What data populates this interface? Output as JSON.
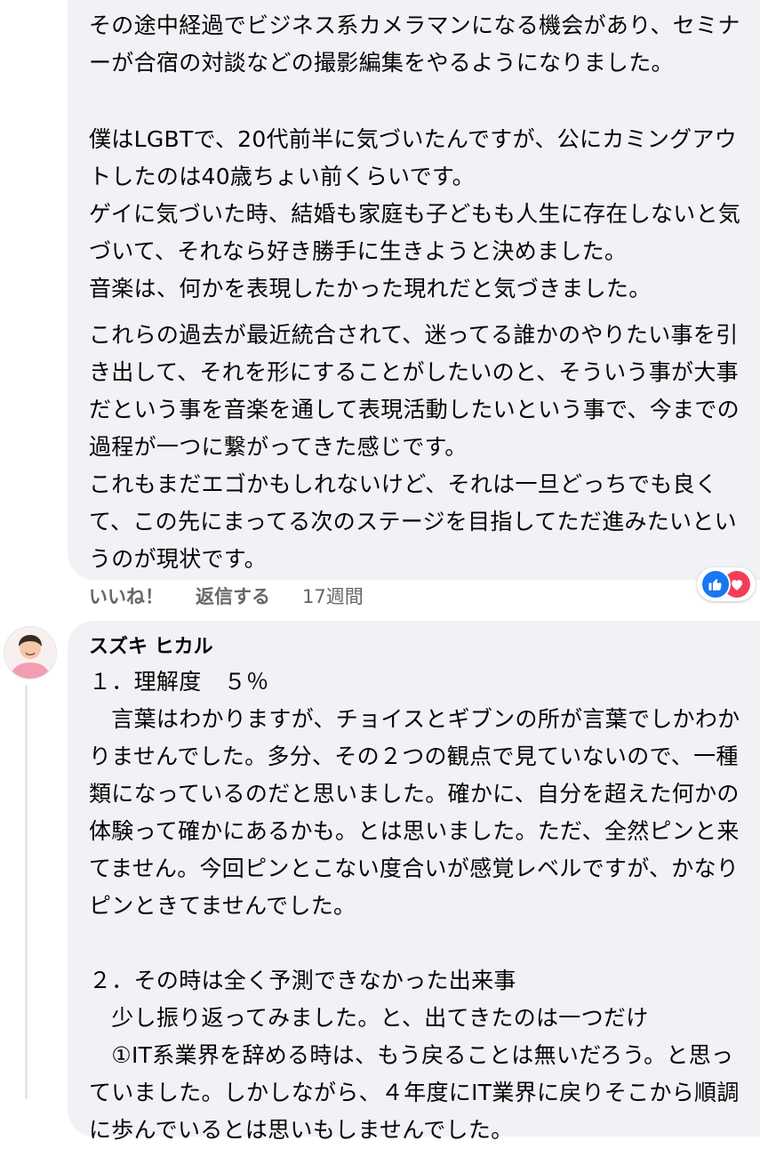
{
  "comment1": {
    "paragraphs": [
      "その途中経過でビジネス系カメラマンになる機会があり、セミナーが合宿の対談などの撮影編集をやるようになりました。",
      "僕はLGBTで、20代前半に気づいたんですが、公にカミングアウトしたのは40歳ちょい前くらいです。\nゲイに気づいた時、結婚も家庭も子どもも人生に存在しないと気づいて、それなら好き勝手に生きようと決めました。",
      "音楽は、何かを表現したかった現れだと気づきました。",
      "これらの過去が最近統合されて、迷ってる誰かのやりたい事を引き出して、それを形にすることがしたいのと、そういう事が大事だという事を音楽を通して表現活動したいという事で、今までの過程が一つに繋がってきた感じです。",
      "これもまだエゴかもしれないけど、それは一旦どっちでも良くて、この先にまってる次のステージを目指してただ進みたいというのが現状です。"
    ],
    "actions": {
      "like": "いいね！",
      "reply": "返信する",
      "time": "17週間"
    },
    "reactions": [
      "like-icon",
      "love-icon"
    ]
  },
  "comment2": {
    "author": "スズキ ヒカル",
    "body": "１．理解度　５％\n　言葉はわかりますが、チョイスとギブンの所が言葉でしかわかりませんでした。多分、その２つの観点で見ていないので、一種類になっているのだと思いました。確かに、自分を超えた何かの体験って確かにあるかも。とは思いました。ただ、全然ピンと来てません。今回ピンとこない度合いが感覚レベルですが、かなりピンときてませんでした。\n\n２．その時は全く予測できなかった出来事\n　少し振り返ってみました。と、出てきたのは一つだけ\n　①IT系業界を辞める時は、もう戻ることは無いだろう。と思っていました。しかしながら、４年度にIT業界に戻りそこから順調に歩んでいるとは思いもしませんでした。"
  },
  "colors": {
    "bubble": "#f0f2f5",
    "meta": "#65676b",
    "like": "#1877f2",
    "love": "#f33e58"
  }
}
